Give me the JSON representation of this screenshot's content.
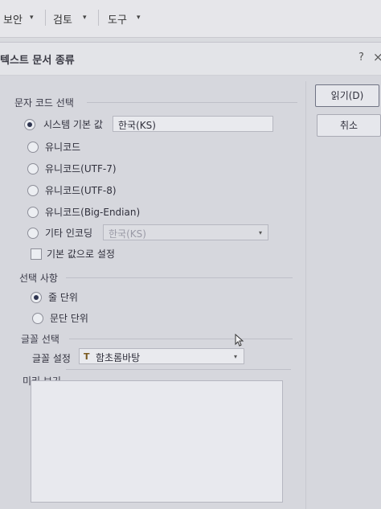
{
  "menu": {
    "items": [
      "보안",
      "검토",
      "도구"
    ]
  },
  "dialog": {
    "title": "텍스트 문서 종류",
    "help": "?",
    "close": "×"
  },
  "encoding_group": {
    "label": "문자 코드 선택",
    "options": [
      {
        "label": "시스템 기본 값",
        "checked": true
      },
      {
        "label": "유니코드",
        "checked": false
      },
      {
        "label": "유니코드(UTF-7)",
        "checked": false
      },
      {
        "label": "유니코드(UTF-8)",
        "checked": false
      },
      {
        "label": "유니코드(Big-Endian)",
        "checked": false
      },
      {
        "label": "기타 인코딩",
        "checked": false
      }
    ],
    "system_default_value": "한국(KS)",
    "other_encoding_value": "한국(KS)",
    "set_default_label": "기본 값으로 설정"
  },
  "selection_group": {
    "label": "선택 사항",
    "options": [
      {
        "label": "줄 단위",
        "checked": true
      },
      {
        "label": "문단 단위",
        "checked": false
      }
    ]
  },
  "font_group": {
    "label": "글꼴 선택",
    "setting_label": "글꼴 설정",
    "font_value": "함초롬바탕",
    "font_glyph": "T"
  },
  "preview_group": {
    "label": "미리 보기"
  },
  "buttons": {
    "read": "읽기(D)",
    "cancel": "취소"
  }
}
